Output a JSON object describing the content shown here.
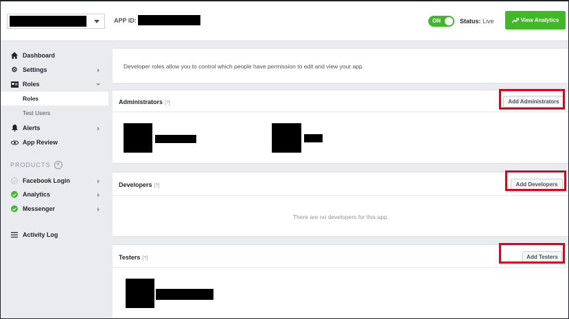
{
  "header": {
    "app_id_label": "APP ID:",
    "toggle_label": "ON",
    "status_label": "Status:",
    "status_value": "Live",
    "analytics_button": "View Analytics"
  },
  "sidebar": {
    "items": [
      {
        "label": "Dashboard",
        "icon": "home-icon"
      },
      {
        "label": "Settings",
        "icon": "gear-icon"
      },
      {
        "label": "Roles",
        "icon": "id-card-icon"
      },
      {
        "label": "Roles"
      },
      {
        "label": "Test Users"
      },
      {
        "label": "Alerts",
        "icon": "bell-icon"
      },
      {
        "label": "App Review",
        "icon": "eye-icon"
      }
    ],
    "products_heading": "PRODUCTS",
    "products": [
      {
        "label": "Facebook Login",
        "status": "inactive"
      },
      {
        "label": "Analytics",
        "status": "active"
      },
      {
        "label": "Messenger",
        "status": "active"
      }
    ],
    "activity_log": "Activity Log"
  },
  "main": {
    "intro": "Developer roles allow you to control which people have permission to edit and view your app.",
    "help_marker": "[?]",
    "administrators": {
      "title": "Administrators",
      "button": "Add Administrators"
    },
    "developers": {
      "title": "Developers",
      "button": "Add Developers",
      "empty": "There are no developers for this app."
    },
    "testers": {
      "title": "Testers",
      "button": "Add Testers"
    }
  },
  "colors": {
    "accent_green": "#42b72a",
    "highlight_red": "#e0001a",
    "background": "#e9ebee"
  }
}
